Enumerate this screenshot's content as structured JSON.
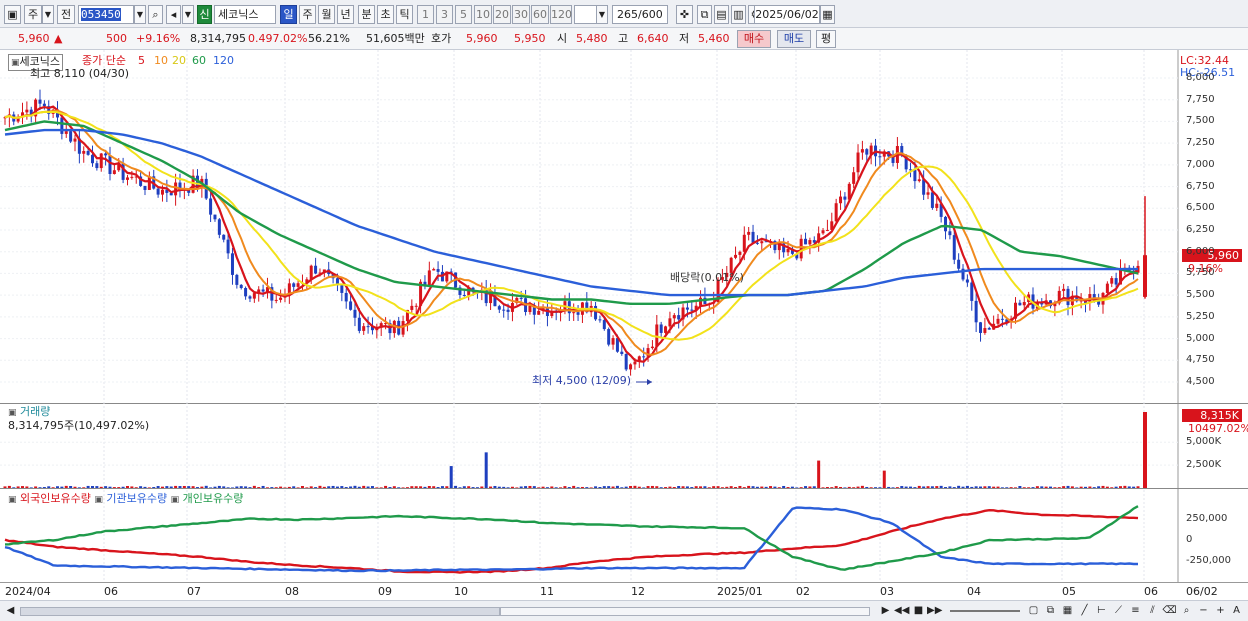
{
  "toolbar": {
    "period_label": "주",
    "prev_label": "전",
    "stock_code": "053450",
    "market_badge": "신",
    "stock_name": "세코닉스",
    "period_tabs": [
      "일",
      "주",
      "월",
      "년",
      "분",
      "초",
      "틱"
    ],
    "interval_tabs": [
      "1",
      "3",
      "5",
      "10",
      "20",
      "30",
      "60",
      "120"
    ],
    "bar_count": "265",
    "bar_total": "/600",
    "date": "2025/06/02"
  },
  "quote": {
    "price": "5,960",
    "change_arrow": "▲",
    "change": "500",
    "change_pct": "+9.16%",
    "volume": "8,314,795",
    "volume_ratio": "0.497.02%",
    "turnover_rate": "56.21%",
    "amount": "51,605백만",
    "bid_label": "호가",
    "ask_price": "5,960",
    "bid_price": "5,950",
    "open_label": "시",
    "open": "5,480",
    "high_label": "고",
    "high": "6,640",
    "low_label": "저",
    "low": "5,460",
    "buy_label": "매수",
    "sell_label": "매도",
    "avg_label": "평"
  },
  "price_panel": {
    "name_tag": "세코닉스",
    "ma_title": "종가 단순",
    "ma_periods": [
      "5",
      "10",
      "20",
      "60",
      "120"
    ],
    "ma_colors": [
      "#d8141c",
      "#f08a1e",
      "#f2e21b",
      "#1f9a4a",
      "#2b5fd9"
    ],
    "max_label": "최고 8,110 (04/30)",
    "min_label": "최저 4,500 (12/09)",
    "ex_dividend_label": "배당락(0.01%)",
    "lc_label": "LC:32.44",
    "hc_label": "HC:-26.51",
    "last_price_tag": "5,960",
    "last_change_tag": "9.16%",
    "y_ticks": [
      "8,000",
      "7,750",
      "7,500",
      "7,250",
      "7,000",
      "6,750",
      "6,500",
      "6,250",
      "6,000",
      "5,750",
      "5,500",
      "5,250",
      "5,000",
      "4,750",
      "4,500"
    ]
  },
  "volume_panel": {
    "title": "거래량",
    "value_label": "8,314,795주(10,497.02%)",
    "tag_value": "8,315K",
    "tag_pct": "10497.02%",
    "y_ticks": [
      "5,000K",
      "2,500K"
    ]
  },
  "holders_panel": {
    "legend": [
      "외국인보유수량",
      "기관보유수량",
      "개인보유수량"
    ],
    "legend_colors": [
      "#d8141c",
      "#2b5fd9",
      "#1f9a4a"
    ],
    "y_ticks": [
      "250,000",
      "0",
      "-250,000"
    ]
  },
  "x_axis": {
    "labels": [
      "2024/04",
      "06",
      "07",
      "08",
      "09",
      "10",
      "11",
      "12",
      "2025/01",
      "02",
      "03",
      "04",
      "05",
      "06"
    ],
    "end_label": "06/02"
  },
  "chart_data": {
    "type": "candlestick",
    "x_range": [
      "2024/04",
      "2025/06/02"
    ],
    "ylim": [
      4500,
      8000
    ],
    "series": [
      {
        "name": "5",
        "values": [
          7550,
          7700,
          7150,
          6900,
          6700,
          6800,
          5600,
          5450,
          5850,
          5200,
          5100,
          5800,
          5500,
          5400,
          5350,
          5400,
          4600,
          5300,
          5400,
          6150,
          5950,
          6200,
          7200,
          7100,
          6350,
          5100,
          5400,
          5500,
          5450,
          5900
        ]
      },
      {
        "name": "60",
        "values": [
          7400,
          7500,
          7450,
          7250,
          7050,
          6800,
          6450,
          6200,
          6000,
          5800,
          5650,
          5600,
          5550,
          5500,
          5450,
          5450,
          5400,
          5400,
          5450,
          5500,
          5500,
          5550,
          5800,
          6100,
          6300,
          6250,
          6000,
          5950,
          5850,
          5750
        ]
      },
      {
        "name": "120",
        "values": [
          7350,
          7400,
          7400,
          7350,
          7250,
          7100,
          6900,
          6700,
          6500,
          6300,
          6150,
          6000,
          5900,
          5800,
          5700,
          5600,
          5550,
          5500,
          5500,
          5500,
          5500,
          5550,
          5600,
          5700,
          5750,
          5800,
          5800,
          5800,
          5800,
          5800
        ]
      }
    ],
    "max_point": {
      "label": "04/30",
      "value": 8110
    },
    "min_point": {
      "label": "12/09",
      "value": 4500
    },
    "last": {
      "open": 5480,
      "high": 6640,
      "low": 5460,
      "close": 5960,
      "change_pct": 9.16
    }
  }
}
